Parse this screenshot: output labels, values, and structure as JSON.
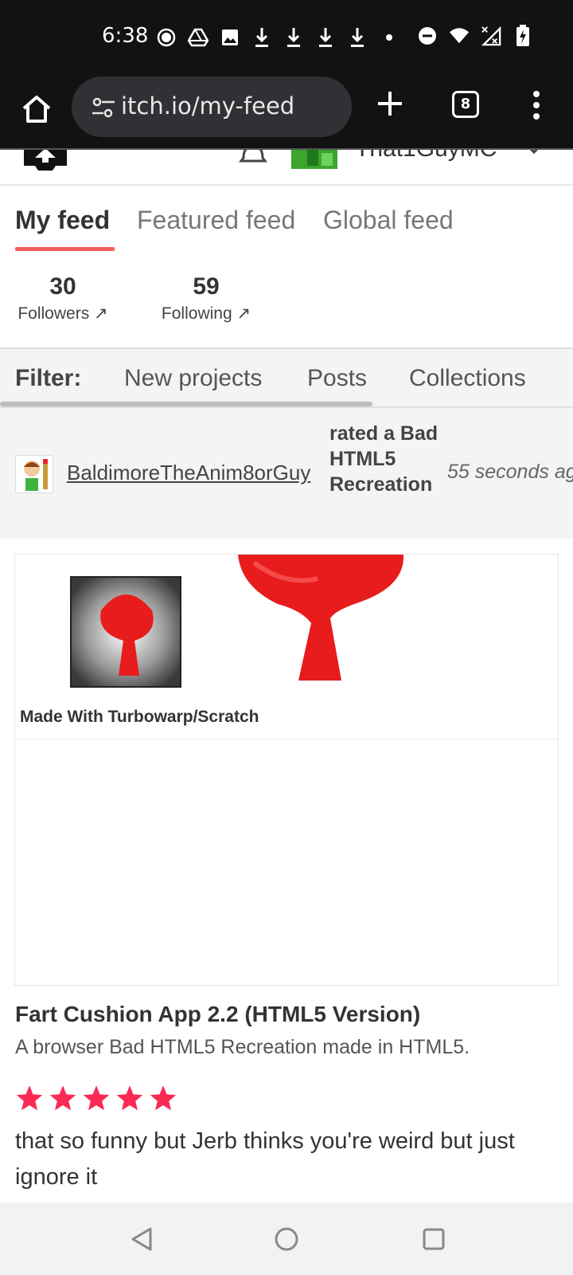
{
  "status_bar": {
    "time": "6:38",
    "icons_left": [
      "record-icon",
      "drive-icon",
      "image-icon",
      "download-icon",
      "download-icon",
      "download-icon",
      "download-icon",
      "dot-icon"
    ],
    "icons_right": [
      "dnd-icon",
      "wifi-icon",
      "signal-icon",
      "battery-charging-icon"
    ]
  },
  "browser": {
    "url": "itch.io/my-feed",
    "tab_count": "8"
  },
  "header": {
    "username": "That1GuyMC"
  },
  "feed_tabs": {
    "items": [
      {
        "label": "My feed",
        "active": true
      },
      {
        "label": "Featured feed",
        "active": false
      },
      {
        "label": "Global feed",
        "active": false
      }
    ]
  },
  "stats": {
    "followers_count": "30",
    "followers_label": "Followers ↗",
    "following_count": "59",
    "following_label": "Following ↗"
  },
  "filter": {
    "label": "Filter:",
    "options": [
      "New projects",
      "Posts",
      "Collections"
    ]
  },
  "event": {
    "user": "BaldimoreTheAnim8orGuy",
    "action": "rated a Bad HTML5 Recreation",
    "time": "55 seconds ago"
  },
  "game": {
    "banner_caption": "Made With Turbowarp/Scratch",
    "title": "Fart Cushion App 2.2 (HTML5 Version)",
    "description": "A browser Bad HTML5 Recreation made in HTML5.",
    "rating": 5,
    "rating_max": 5,
    "comment": "that so funny but Jerb thinks you're weird but just ignore it"
  },
  "colors": {
    "accent": "#fa5c5c",
    "star": "#fa2a55",
    "cushion": "#e81c1c"
  }
}
